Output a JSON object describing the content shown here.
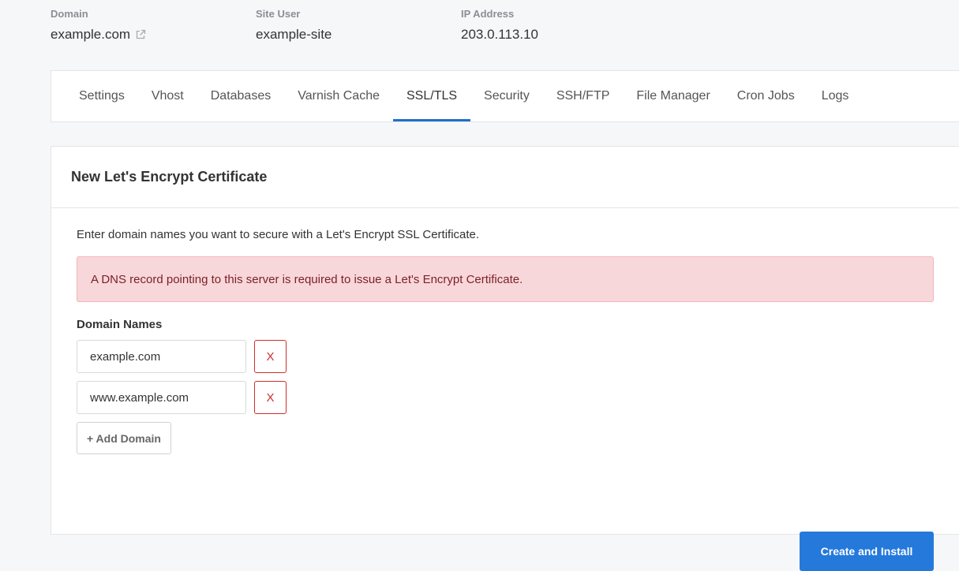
{
  "site_info": {
    "domain_label": "Domain",
    "domain_value": "example.com",
    "user_label": "Site User",
    "user_value": "example-site",
    "ip_label": "IP Address",
    "ip_value": "203.0.113.10"
  },
  "tabs": [
    {
      "label": "Settings"
    },
    {
      "label": "Vhost"
    },
    {
      "label": "Databases"
    },
    {
      "label": "Varnish Cache"
    },
    {
      "label": "SSL/TLS",
      "active": true
    },
    {
      "label": "Security"
    },
    {
      "label": "SSH/FTP"
    },
    {
      "label": "File Manager"
    },
    {
      "label": "Cron Jobs"
    },
    {
      "label": "Logs"
    }
  ],
  "card": {
    "title": "New Let's Encrypt Certificate",
    "intro": "Enter domain names you want to secure with a Let's Encrypt SSL Certificate.",
    "alert": "A DNS record pointing to this server is required to issue a Let's Encrypt Certificate.",
    "domains_label": "Domain Names",
    "domains": [
      {
        "value": "example.com",
        "remove_label": "X"
      },
      {
        "value": "www.example.com",
        "remove_label": "X"
      }
    ],
    "add_label": "+ Add Domain",
    "submit_label": "Create and Install"
  },
  "colors": {
    "accent": "#2579db",
    "danger": "#c9302c",
    "alert_bg": "#f8d7da"
  }
}
